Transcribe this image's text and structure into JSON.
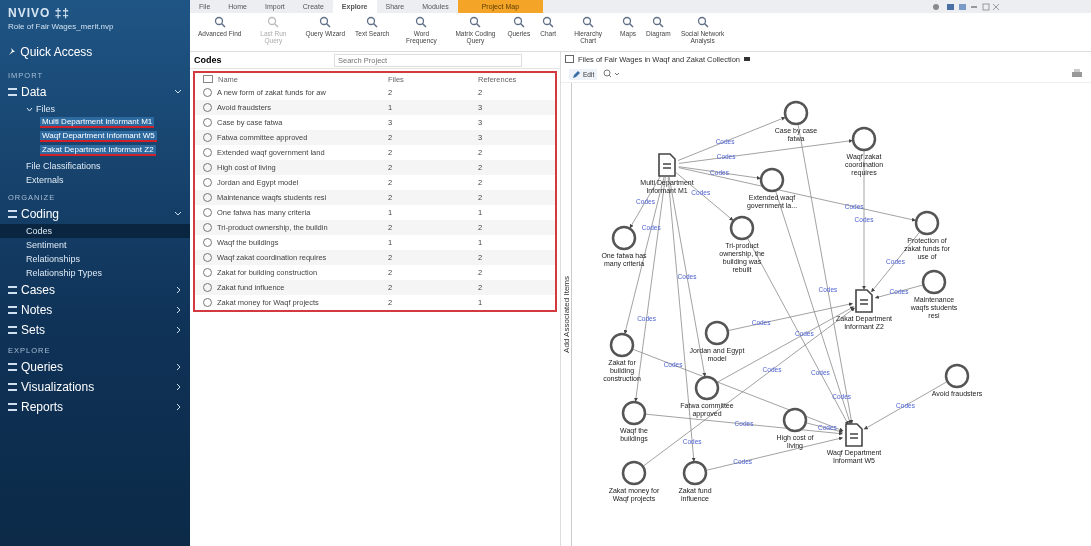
{
  "sidebar": {
    "app_title": "NVIVO ‡‡",
    "project": "Role of Fair Wages_merit.nvp",
    "quick_access": "Quick Access",
    "sections": [
      {
        "label": "IMPORT",
        "groups": [
          {
            "label": "Data",
            "expanded": true,
            "children": [
              {
                "label": "Files",
                "expanded": true,
                "selected": false,
                "children": [
                  {
                    "label": "Multi Department Informant M1",
                    "marked": true,
                    "selected": false
                  },
                  {
                    "label": "Waqf Department Informant W5",
                    "marked": true,
                    "selected": false
                  },
                  {
                    "label": "Zakat Department Informant Z2",
                    "marked": true,
                    "selected": false
                  }
                ]
              },
              {
                "label": "File Classifications",
                "selected": false
              },
              {
                "label": "Externals",
                "selected": false
              }
            ]
          }
        ]
      },
      {
        "label": "ORGANIZE",
        "groups": [
          {
            "label": "Coding",
            "expanded": true,
            "children": [
              {
                "label": "Codes",
                "selected": true
              },
              {
                "label": "Sentiment",
                "selected": false
              },
              {
                "label": "Relationships",
                "selected": false
              },
              {
                "label": "Relationship Types",
                "selected": false
              }
            ]
          },
          {
            "label": "Cases",
            "expanded": false
          },
          {
            "label": "Notes",
            "expanded": false
          },
          {
            "label": "Sets",
            "expanded": false
          }
        ]
      },
      {
        "label": "EXPLORE",
        "groups": [
          {
            "label": "Queries",
            "expanded": false
          },
          {
            "label": "Visualizations",
            "expanded": false
          },
          {
            "label": "Reports",
            "expanded": false
          }
        ]
      }
    ]
  },
  "ribbon": {
    "tabs": [
      {
        "label": "File",
        "selected": false,
        "highlight": false
      },
      {
        "label": "Home",
        "selected": false,
        "highlight": false
      },
      {
        "label": "Import",
        "selected": false,
        "highlight": false
      },
      {
        "label": "Create",
        "selected": false,
        "highlight": false
      },
      {
        "label": "Explore",
        "selected": true,
        "highlight": false
      },
      {
        "label": "Share",
        "selected": false,
        "highlight": false
      },
      {
        "label": "Modules",
        "selected": false,
        "highlight": false
      },
      {
        "label": "Project Map",
        "selected": false,
        "highlight": true
      }
    ],
    "buttons": [
      {
        "label": "Advanced Find",
        "disabled": false
      },
      {
        "label": "Last Run Query",
        "disabled": true
      },
      {
        "label": "Query Wizard",
        "disabled": false
      },
      {
        "label": "Text Search",
        "disabled": false
      },
      {
        "label": "Word Frequency",
        "disabled": false
      },
      {
        "label": "Matrix Coding Query",
        "disabled": false
      },
      {
        "label": "Queries",
        "disabled": false
      },
      {
        "label": "Chart",
        "disabled": false
      },
      {
        "label": "Hierarchy Chart",
        "disabled": false
      },
      {
        "label": "Maps",
        "disabled": false
      },
      {
        "label": "Diagram",
        "disabled": false
      },
      {
        "label": "Social Network Analysis",
        "disabled": false
      }
    ]
  },
  "codes": {
    "title": "Codes",
    "search": {
      "placeholder": "Search Project"
    },
    "columns": [
      "Name",
      "Files",
      "References"
    ],
    "rows": [
      {
        "name": "A new form of zakat funds for aw",
        "files": "2",
        "references": "2"
      },
      {
        "name": "Avoid fraudsters",
        "files": "1",
        "references": "3"
      },
      {
        "name": "Case by case fatwa",
        "files": "3",
        "references": "3"
      },
      {
        "name": "Fatwa committee approved",
        "files": "2",
        "references": "3"
      },
      {
        "name": "Extended waqf government land",
        "files": "2",
        "references": "2"
      },
      {
        "name": "High cost of living",
        "files": "2",
        "references": "2"
      },
      {
        "name": "Jordan and Egypt model",
        "files": "2",
        "references": "2"
      },
      {
        "name": "Maintenance waqfs students resi",
        "files": "2",
        "references": "2"
      },
      {
        "name": "One fatwa has many criteria",
        "files": "1",
        "references": "1"
      },
      {
        "name": "Tri-product ownership, the buildin",
        "files": "2",
        "references": "2"
      },
      {
        "name": "Waqf the buildings",
        "files": "1",
        "references": "1"
      },
      {
        "name": "Waqf zakat coordination requires",
        "files": "2",
        "references": "2"
      },
      {
        "name": "Zakat for building construction",
        "files": "2",
        "references": "2"
      },
      {
        "name": "Zakat fund influence",
        "files": "2",
        "references": "2"
      },
      {
        "name": "Zakat money for Waqf projects",
        "files": "2",
        "references": "1"
      }
    ]
  },
  "map": {
    "title": "Files of Fair Wages in Waqf and Zakat Collection",
    "edit": "Edit",
    "side_label": "Add Associated Items",
    "nodes": [
      {
        "kind": "file",
        "label": "Multi Department Informant M1"
      },
      {
        "kind": "code",
        "label": "Case by case fatwa"
      },
      {
        "kind": "code",
        "label": "Waqf zakat coordination requires"
      },
      {
        "kind": "code",
        "label": "Extended waqf government la..."
      },
      {
        "kind": "code",
        "label": "One fatwa has many criteria"
      },
      {
        "kind": "code",
        "label": "Tri-product ownership, the building was rebuilt"
      },
      {
        "kind": "code",
        "label": "Protection of zakat funds for use of"
      },
      {
        "kind": "code",
        "label": "Maintenance waqfs students resi"
      },
      {
        "kind": "file",
        "label": "Zakat Department Informant Z2"
      },
      {
        "kind": "code",
        "label": "Jordan and Egypt model"
      },
      {
        "kind": "code",
        "label": "Zakat for building construction"
      },
      {
        "kind": "code",
        "label": "Fatwa committee approved"
      },
      {
        "kind": "code",
        "label": "Waqf the buildings"
      },
      {
        "kind": "code",
        "label": "High cost of living"
      },
      {
        "kind": "file",
        "label": "Waqf Department Informant W5"
      },
      {
        "kind": "code",
        "label": "Zakat money for Waqf projects"
      },
      {
        "kind": "code",
        "label": "Zakat fund influence"
      },
      {
        "kind": "code",
        "label": "Avoid fraudsters"
      }
    ],
    "edges": [
      {
        "label": "Codes"
      },
      {
        "label": "Codes"
      },
      {
        "label": "Codes"
      },
      {
        "label": "Codes"
      },
      {
        "label": "Codes"
      },
      {
        "label": "Codes"
      },
      {
        "label": "Codes"
      },
      {
        "label": "Codes"
      },
      {
        "label": "Codes"
      },
      {
        "label": "Codes"
      },
      {
        "label": "Codes"
      },
      {
        "label": "Codes"
      },
      {
        "label": "Codes"
      },
      {
        "label": "Codes"
      },
      {
        "label": "Codes"
      },
      {
        "label": "Codes"
      },
      {
        "label": "Codes"
      },
      {
        "label": "Codes"
      },
      {
        "label": "Codes"
      },
      {
        "label": "Codes"
      },
      {
        "label": "Codes"
      },
      {
        "label": "Codes"
      },
      {
        "label": "Codes"
      },
      {
        "label": "Codes"
      }
    ]
  }
}
